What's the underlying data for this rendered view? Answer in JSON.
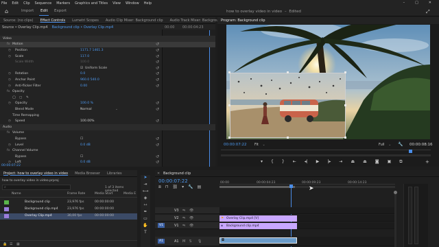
{
  "menu": [
    "File",
    "Edit",
    "Clip",
    "Sequence",
    "Markers",
    "Graphics and Titles",
    "View",
    "Window",
    "Help"
  ],
  "workspace_tabs": [
    "Import",
    "Edit",
    "Export"
  ],
  "document_title": "how to overlay video in video",
  "document_state": "Edited",
  "source_tabs": [
    "Source: (no clips)",
    "Effect Controls",
    "Lumetri Scopes",
    "Audio Clip Mixer: Background clip",
    "Audio Track Mixer: Background cl"
  ],
  "ec_breadcrumb": "Source • Overlay Clip.mp4",
  "ec_breadcrumb2": "Background clip • Overlay Clip.mp4",
  "ec_time": "00:00",
  "ec_time2": "00:00:04:23",
  "ec_clip_label": "Overlay Clip.mp4",
  "ec_rows": {
    "video": "Video",
    "motion": "Motion",
    "position": "Position",
    "position_val": "1171.7     1461.3",
    "scale": "Scale",
    "scale_val": "117.0",
    "scale_width": "Scale Width",
    "scale_width_val": "100.0",
    "uniform": "Uniform Scale",
    "rotation": "Rotation",
    "rotation_val": "0.0",
    "anchor": "Anchor Point",
    "anchor_val": "960.0     540.0",
    "antiflicker": "Anti-flicker Filter",
    "antiflicker_val": "0.00",
    "opacity": "Opacity",
    "opacity_val": "100.0 %",
    "blend": "Blend Mode",
    "blend_val": "Normal",
    "remap": "Time Remapping",
    "speed": "Speed",
    "speed_val": "100.00%",
    "audio": "Audio",
    "volume": "Volume",
    "bypass": "Bypass",
    "level": "Level",
    "level_val": "0.0  dB",
    "channel_volume": "Channel Volume",
    "bypass2": "Bypass",
    "left": "Left",
    "left_val": "0.0  dB",
    "right": "Right",
    "right_val": "0.0  dB"
  },
  "ec_footer_time": "00:00:07:22",
  "program": {
    "title": "Program: Background clip",
    "timecode_left": "00:00:07:22",
    "timecode_right": "00:00:08:16",
    "fit": "Fit",
    "full": "Full"
  },
  "project": {
    "tabs": [
      "Project: how to overlay video in video",
      "Media Browser",
      "Libraries"
    ],
    "path": "how to overlay video in video.prproj",
    "count": "1 of 3 items selected",
    "columns": [
      "Name",
      "Frame Rate",
      "Media Start",
      "Media E"
    ],
    "items": [
      {
        "name": "Background clip",
        "rate": "23,976 fps",
        "start": "00:00:00:00",
        "color": "#5ab54a"
      },
      {
        "name": "Background clip.mp4",
        "rate": "23,976 fps",
        "start": "00:00:00:00",
        "color": "#9b7ddc"
      },
      {
        "name": "Overlay Clip.mp4",
        "rate": "30,00 fps",
        "start": "00:00:00:00",
        "color": "#9b7ddc"
      }
    ]
  },
  "timeline": {
    "title": "Background clip",
    "timecode": "00:00:07:22",
    "ruler": [
      "00:00",
      "00:00:04:23",
      "00:00:09:23",
      "00:00:14:23"
    ],
    "tracks": [
      {
        "name": "V3"
      },
      {
        "name": "V2"
      },
      {
        "name": "V1"
      },
      {
        "name": "A1"
      }
    ],
    "clips": [
      {
        "label": "Overlay Clip.mp4 [V]",
        "color": "#c9a7ff"
      },
      {
        "label": "Background clip.mp4",
        "color": "#c9a7ff"
      }
    ]
  }
}
